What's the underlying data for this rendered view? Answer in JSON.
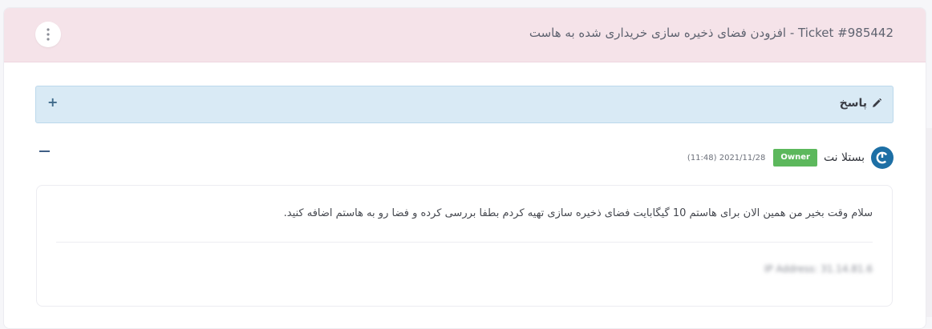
{
  "ticket": {
    "title": "Ticket #985442 - افزودن فضای ذخیره سازی خریداری شده به هاست"
  },
  "reply": {
    "label": "پاسخ",
    "expand_symbol": "+"
  },
  "message": {
    "author": "بستلا نت",
    "badge": "Owner",
    "timestamp": "(11:48) 2021/11/28",
    "text": "سلام وقت بخیر من همین الان برای هاستم 10 گیگابایت فضای ذخیره سازی تهیه کردم بطفا بررسی کرده و فضا رو به هاستم اضافه کنید.",
    "ip_address": "IP Address: 31.14.81.6"
  },
  "colors": {
    "header_bg": "#f5e3e9",
    "reply_bg": "#d9eaf5",
    "owner_badge": "#5cb85c",
    "avatar": "#1d6fa5"
  }
}
